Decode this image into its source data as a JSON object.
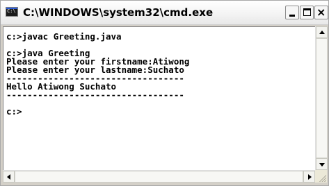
{
  "window": {
    "title": "C:\\WINDOWS\\system32\\cmd.exe",
    "icon": "cmd-icon",
    "icon_text": "C:\\",
    "controls": {
      "minimize": "minimize-icon",
      "maximize": "maximize-icon",
      "close": "close-icon",
      "close_glyph": "×"
    }
  },
  "console": {
    "background": "#ffffff",
    "foreground": "#000000",
    "lines": [
      "c:>javac Greeting.java",
      "",
      "c:>java Greeting",
      "Please enter your firstname:Atiwong",
      "Please enter your lastname:Suchato",
      "----------------------------------",
      "Hello Atiwong Suchato",
      "----------------------------------",
      "",
      "c:>"
    ]
  },
  "scrollbars": {
    "vertical": {
      "position": 0.0
    },
    "horizontal": {
      "position": 0.0
    }
  }
}
